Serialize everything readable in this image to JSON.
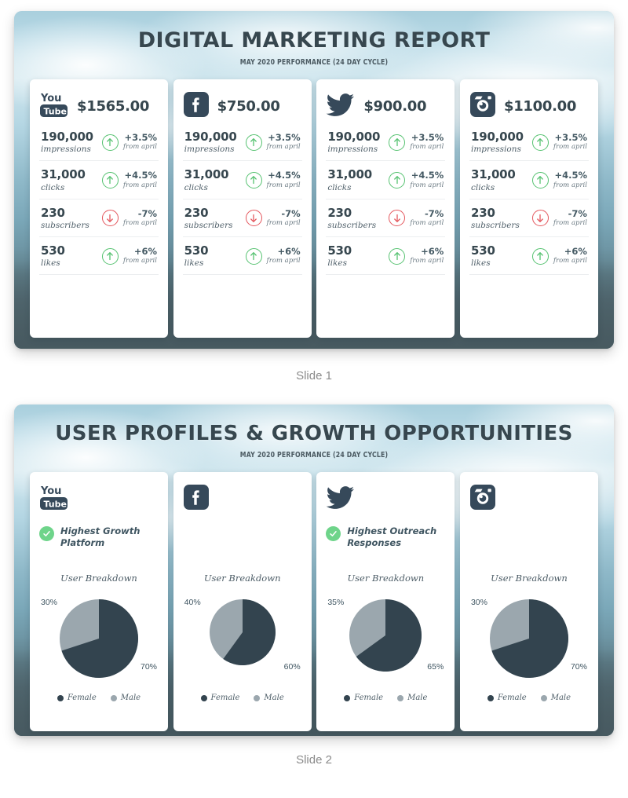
{
  "page": {
    "background": "#ffffff"
  },
  "colors": {
    "dark_navy": "#33444f",
    "gray_slice": "#9ba7ae",
    "green": "#56c271",
    "green_badge": "#6ed48a",
    "red": "#e4575d",
    "title_text": "#37474f",
    "caption_text": "#8b8b8b"
  },
  "slides": [
    {
      "caption": "Slide 1",
      "title": "DIGITAL MARKETING REPORT",
      "subtitle": "MAY 2020 PERFORMANCE (24 DAY CYCLE)",
      "cards": [
        {
          "platform": "youtube",
          "icon": "youtube-icon",
          "amount": "$1565.00",
          "metrics": [
            {
              "value": "190,000",
              "label": "impressions",
              "direction": "up",
              "icon": "arrow-up-circle-icon",
              "percent": "+3.5%",
              "from": "from april"
            },
            {
              "value": "31,000",
              "label": "clicks",
              "direction": "up",
              "icon": "arrow-up-circle-icon",
              "percent": "+4.5%",
              "from": "from april"
            },
            {
              "value": "230",
              "label": "subscribers",
              "direction": "down",
              "icon": "arrow-down-circle-icon",
              "percent": "-7%",
              "from": "from april"
            },
            {
              "value": "530",
              "label": "likes",
              "direction": "up",
              "icon": "arrow-up-circle-icon",
              "percent": "+6%",
              "from": "from april"
            }
          ]
        },
        {
          "platform": "facebook",
          "icon": "facebook-icon",
          "amount": "$750.00",
          "metrics": [
            {
              "value": "190,000",
              "label": "impressions",
              "direction": "up",
              "icon": "arrow-up-circle-icon",
              "percent": "+3.5%",
              "from": "from april"
            },
            {
              "value": "31,000",
              "label": "clicks",
              "direction": "up",
              "icon": "arrow-up-circle-icon",
              "percent": "+4.5%",
              "from": "from april"
            },
            {
              "value": "230",
              "label": "subscribers",
              "direction": "down",
              "icon": "arrow-down-circle-icon",
              "percent": "-7%",
              "from": "from april"
            },
            {
              "value": "530",
              "label": "likes",
              "direction": "up",
              "icon": "arrow-up-circle-icon",
              "percent": "+6%",
              "from": "from april"
            }
          ]
        },
        {
          "platform": "twitter",
          "icon": "twitter-icon",
          "amount": "$900.00",
          "metrics": [
            {
              "value": "190,000",
              "label": "impressions",
              "direction": "up",
              "icon": "arrow-up-circle-icon",
              "percent": "+3.5%",
              "from": "from april"
            },
            {
              "value": "31,000",
              "label": "clicks",
              "direction": "up",
              "icon": "arrow-up-circle-icon",
              "percent": "+4.5%",
              "from": "from april"
            },
            {
              "value": "230",
              "label": "subscribers",
              "direction": "down",
              "icon": "arrow-down-circle-icon",
              "percent": "-7%",
              "from": "from april"
            },
            {
              "value": "530",
              "label": "likes",
              "direction": "up",
              "icon": "arrow-up-circle-icon",
              "percent": "+6%",
              "from": "from april"
            }
          ]
        },
        {
          "platform": "instagram",
          "icon": "instagram-icon",
          "amount": "$1100.00",
          "metrics": [
            {
              "value": "190,000",
              "label": "impressions",
              "direction": "up",
              "icon": "arrow-up-circle-icon",
              "percent": "+3.5%",
              "from": "from april"
            },
            {
              "value": "31,000",
              "label": "clicks",
              "direction": "up",
              "icon": "arrow-up-circle-icon",
              "percent": "+4.5%",
              "from": "from april"
            },
            {
              "value": "230",
              "label": "subscribers",
              "direction": "down",
              "icon": "arrow-down-circle-icon",
              "percent": "-7%",
              "from": "from april"
            },
            {
              "value": "530",
              "label": "likes",
              "direction": "up",
              "icon": "arrow-up-circle-icon",
              "percent": "+6%",
              "from": "from april"
            }
          ]
        }
      ]
    },
    {
      "caption": "Slide 2",
      "title": "USER PROFILES & GROWTH OPPORTUNITIES",
      "subtitle": "MAY 2020 PERFORMANCE (24 DAY CYCLE)",
      "cards": [
        {
          "platform": "youtube",
          "icon": "youtube-icon",
          "badge": "Highest Growth Platform",
          "has_badge": true,
          "breakdown_title": "User Breakdown",
          "pie_size": 100,
          "chart": {
            "type": "pie",
            "title": "User Breakdown",
            "labels": [
              "Female",
              "Male"
            ],
            "values": [
              70,
              30
            ],
            "display": [
              "70%",
              "30%"
            ],
            "colors": [
              "#33444f",
              "#9ba7ae"
            ]
          },
          "legend": [
            {
              "label": "Female",
              "color": "#33444f"
            },
            {
              "label": "Male",
              "color": "#9ba7ae"
            }
          ]
        },
        {
          "platform": "facebook",
          "icon": "facebook-icon",
          "badge": "",
          "has_badge": false,
          "breakdown_title": "User Breakdown",
          "pie_size": 84,
          "chart": {
            "type": "pie",
            "title": "User Breakdown",
            "labels": [
              "Female",
              "Male"
            ],
            "values": [
              60,
              40
            ],
            "display": [
              "60%",
              "40%"
            ],
            "colors": [
              "#33444f",
              "#9ba7ae"
            ]
          },
          "legend": [
            {
              "label": "Female",
              "color": "#33444f"
            },
            {
              "label": "Male",
              "color": "#9ba7ae"
            }
          ]
        },
        {
          "platform": "twitter",
          "icon": "twitter-icon",
          "badge": "Highest Outreach Responses",
          "has_badge": true,
          "breakdown_title": "User Breakdown",
          "pie_size": 92,
          "chart": {
            "type": "pie",
            "title": "User Breakdown",
            "labels": [
              "Female",
              "Male"
            ],
            "values": [
              65,
              35
            ],
            "display": [
              "65%",
              "35%"
            ],
            "colors": [
              "#33444f",
              "#9ba7ae"
            ]
          },
          "legend": [
            {
              "label": "Female",
              "color": "#33444f"
            },
            {
              "label": "Male",
              "color": "#9ba7ae"
            }
          ]
        },
        {
          "platform": "instagram",
          "icon": "instagram-icon",
          "badge": "",
          "has_badge": false,
          "breakdown_title": "User Breakdown",
          "pie_size": 100,
          "chart": {
            "type": "pie",
            "title": "User Breakdown",
            "labels": [
              "Female",
              "Male"
            ],
            "values": [
              70,
              30
            ],
            "display": [
              "70%",
              "30%"
            ],
            "colors": [
              "#33444f",
              "#9ba7ae"
            ]
          },
          "legend": [
            {
              "label": "Female",
              "color": "#33444f"
            },
            {
              "label": "Male",
              "color": "#9ba7ae"
            }
          ]
        }
      ]
    }
  ],
  "chart_data": [
    {
      "type": "pie",
      "title": "User Breakdown",
      "platform": "YouTube",
      "categories": [
        "Female",
        "Male"
      ],
      "values": [
        70,
        30
      ],
      "colors": [
        "#33444f",
        "#9ba7ae"
      ],
      "legend_position": "bottom"
    },
    {
      "type": "pie",
      "title": "User Breakdown",
      "platform": "Facebook",
      "categories": [
        "Female",
        "Male"
      ],
      "values": [
        60,
        40
      ],
      "colors": [
        "#33444f",
        "#9ba7ae"
      ],
      "legend_position": "bottom"
    },
    {
      "type": "pie",
      "title": "User Breakdown",
      "platform": "Twitter",
      "categories": [
        "Female",
        "Male"
      ],
      "values": [
        65,
        35
      ],
      "colors": [
        "#33444f",
        "#9ba7ae"
      ],
      "legend_position": "bottom"
    },
    {
      "type": "pie",
      "title": "User Breakdown",
      "platform": "Instagram",
      "categories": [
        "Female",
        "Male"
      ],
      "values": [
        70,
        30
      ],
      "colors": [
        "#33444f",
        "#9ba7ae"
      ],
      "legend_position": "bottom"
    }
  ]
}
